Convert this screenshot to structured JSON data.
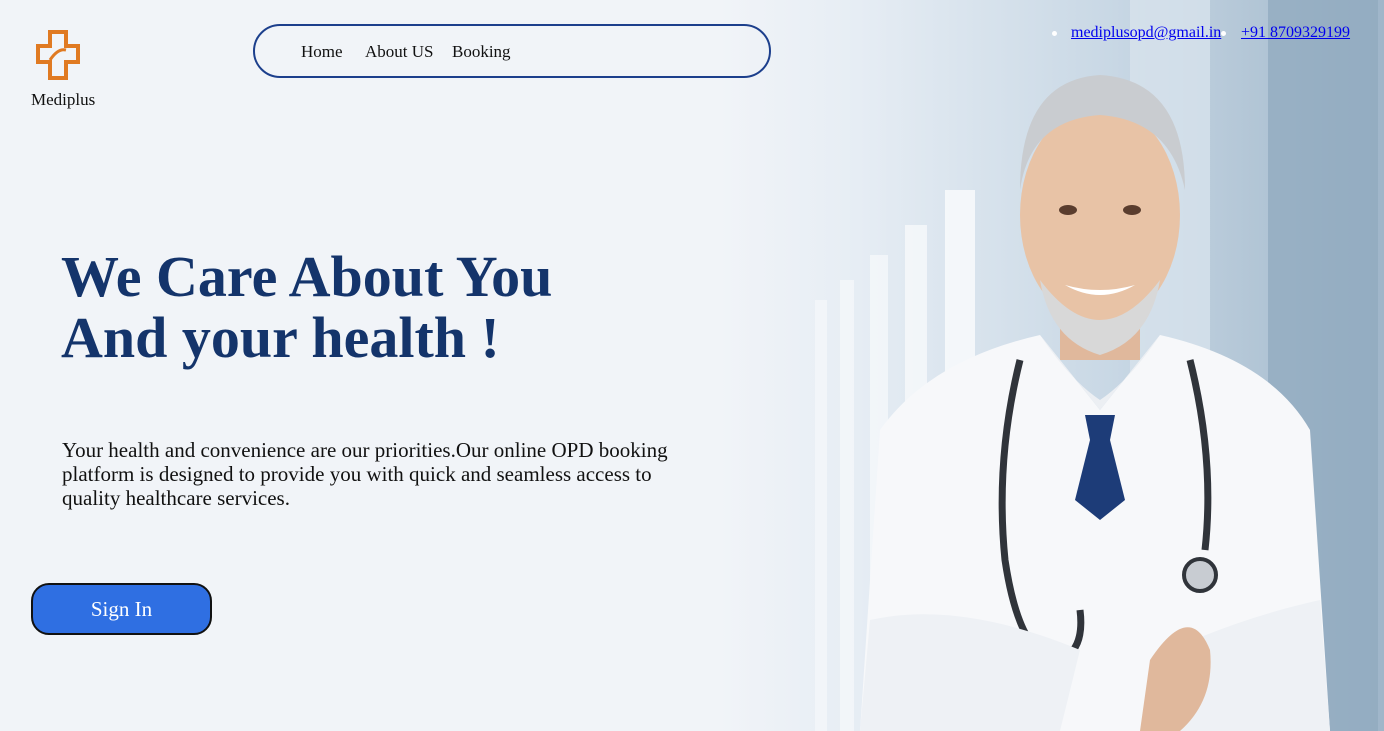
{
  "brand": {
    "name": "Mediplus",
    "logo_icon": "medical-cross-icon",
    "logo_color": "#e07a22"
  },
  "nav": {
    "links": [
      "Home",
      "About US",
      "Booking"
    ]
  },
  "contact": {
    "email": "mediplusopd@gmail.in",
    "phone": "+91 8709329199"
  },
  "hero": {
    "headline_line1": "We Care About You",
    "headline_line2": "And your health !",
    "description": "Your health and convenience are our priorities.Our online OPD booking platform is designed to provide you with quick and seamless access to quality healthcare services.",
    "cta_label": "Sign In",
    "image": "doctor-photo"
  },
  "colors": {
    "headline": "#14346b",
    "cta": "#2f6fe2",
    "nav_border": "#1c3f8c",
    "link": "#0000ee"
  }
}
